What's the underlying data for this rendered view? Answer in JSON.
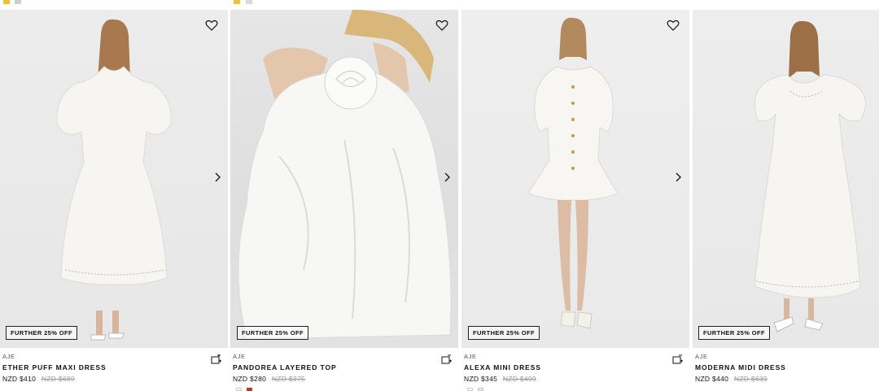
{
  "products": [
    {
      "brand": "AJE",
      "name": "ETHER PUFF MAXI DRESS",
      "price": "NZD $410",
      "original_price": "NZD $689",
      "promo": "FURTHER 25% OFF"
    },
    {
      "brand": "AJE",
      "name": "PANDOREA LAYERED TOP",
      "price": "NZD $280",
      "original_price": "NZD $375",
      "promo": "FURTHER 25% OFF"
    },
    {
      "brand": "AJE",
      "name": "ALEXA MINI DRESS",
      "price": "NZD $345",
      "original_price": "NZD $499",
      "promo": "FURTHER 25% OFF"
    },
    {
      "brand": "AJE",
      "name": "MODERNA MIDI DRESS",
      "price": "NZD $440",
      "original_price": "NZD $639",
      "promo": "FURTHER 25% OFF"
    }
  ],
  "icons": {
    "wishlist": "heart-icon",
    "next_image": "chevron-right-icon",
    "add_to_bag": "add-to-bag-icon"
  },
  "colors": {
    "swatch_white": "#ffffff",
    "swatch_red": "#c0392b",
    "swatch_yellow": "#e8c33a"
  }
}
